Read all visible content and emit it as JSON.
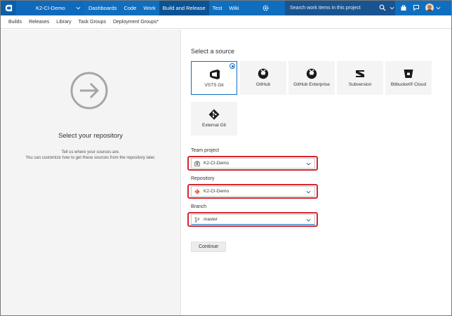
{
  "topbar": {
    "project_name": "K2-CI-Demo",
    "nav": [
      {
        "label": "Dashboards"
      },
      {
        "label": "Code"
      },
      {
        "label": "Work"
      },
      {
        "label": "Build and Release",
        "active": true
      },
      {
        "label": "Test"
      },
      {
        "label": "Wiki"
      }
    ],
    "search_placeholder": "Search work items in this project",
    "colors": {
      "bar": "#106ebe",
      "active": "#0c5394",
      "search": "#1a5490"
    }
  },
  "subnav": {
    "items": [
      {
        "label": "Builds"
      },
      {
        "label": "Releases"
      },
      {
        "label": "Library"
      },
      {
        "label": "Task Groups"
      },
      {
        "label": "Deployment Groups*"
      }
    ]
  },
  "left": {
    "title": "Select your repository",
    "desc_line1": "Tell us where your sources are.",
    "desc_line2": "You can customize how to get these sources from the repository later."
  },
  "source": {
    "title": "Select a source",
    "tiles": [
      {
        "label": "VSTS Git",
        "icon": "vsts-icon",
        "selected": true
      },
      {
        "label": "GitHub",
        "icon": "github-icon"
      },
      {
        "label": "GitHub Enterprise",
        "icon": "github-enterprise-icon"
      },
      {
        "label": "Subversion",
        "icon": "subversion-icon"
      },
      {
        "label": "Bitbucket® Cloud",
        "icon": "bitbucket-icon"
      },
      {
        "label": "External Git",
        "icon": "git-icon"
      }
    ]
  },
  "fields": {
    "team_project": {
      "label": "Team project",
      "value": "K2-CI-Demo"
    },
    "repository": {
      "label": "Repository",
      "value": "K2-CI-Demo"
    },
    "branch": {
      "label": "Branch",
      "value": "master"
    }
  },
  "continue_label": "Continue",
  "accent_color": "#106ebe",
  "highlight_color": "#d9242f"
}
